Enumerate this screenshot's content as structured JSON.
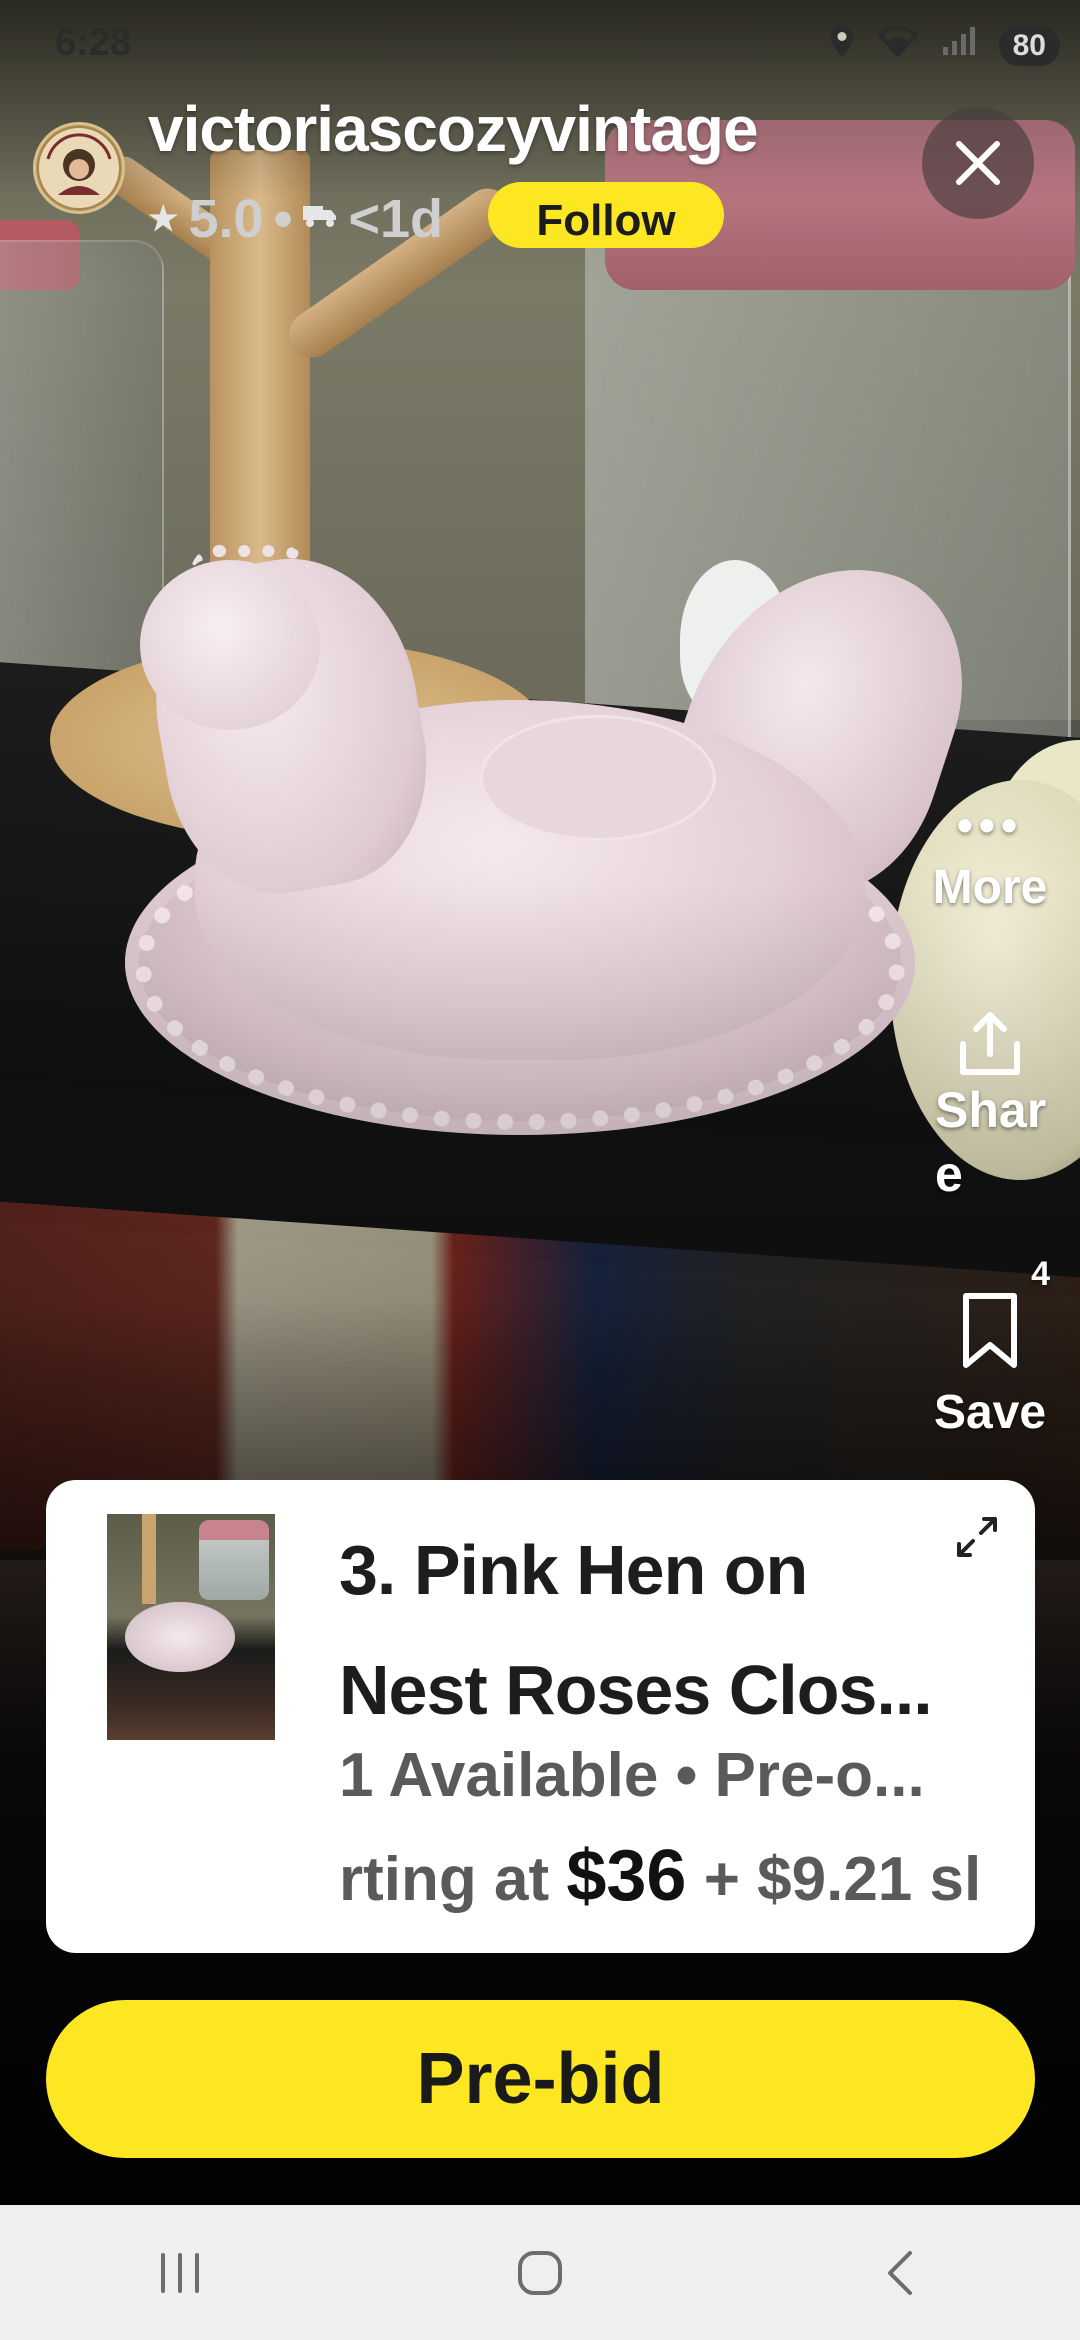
{
  "status_bar": {
    "time": "6:28",
    "battery": "80",
    "icons": [
      "location-icon",
      "wifi-icon",
      "signal-icon",
      "battery-icon"
    ]
  },
  "seller": {
    "name": "victoriascozyvintage",
    "rating": "5.0",
    "ship_time": "<1d",
    "follow_label": "Follow",
    "avatar_text": "VICTORIA'S COZY VINTAGE"
  },
  "actions": {
    "more_label": "More",
    "share_label_line1": "Shar",
    "share_label_line2": "e",
    "save_label": "Save",
    "save_count": "4"
  },
  "product": {
    "title_line1": "3. Pink Hen on",
    "title_line2": "Nest Roses Clos...",
    "availability": "1 Available • Pre-o...",
    "price_prefix": "rting at ",
    "price": "$36",
    "shipping_prefix": " + ",
    "shipping": "$9.21 sl"
  },
  "prebid_label": "Pre-bid",
  "colors": {
    "accent_yellow": "#fde723",
    "card_bg": "#ffffff",
    "nav_bg": "#efefef"
  }
}
